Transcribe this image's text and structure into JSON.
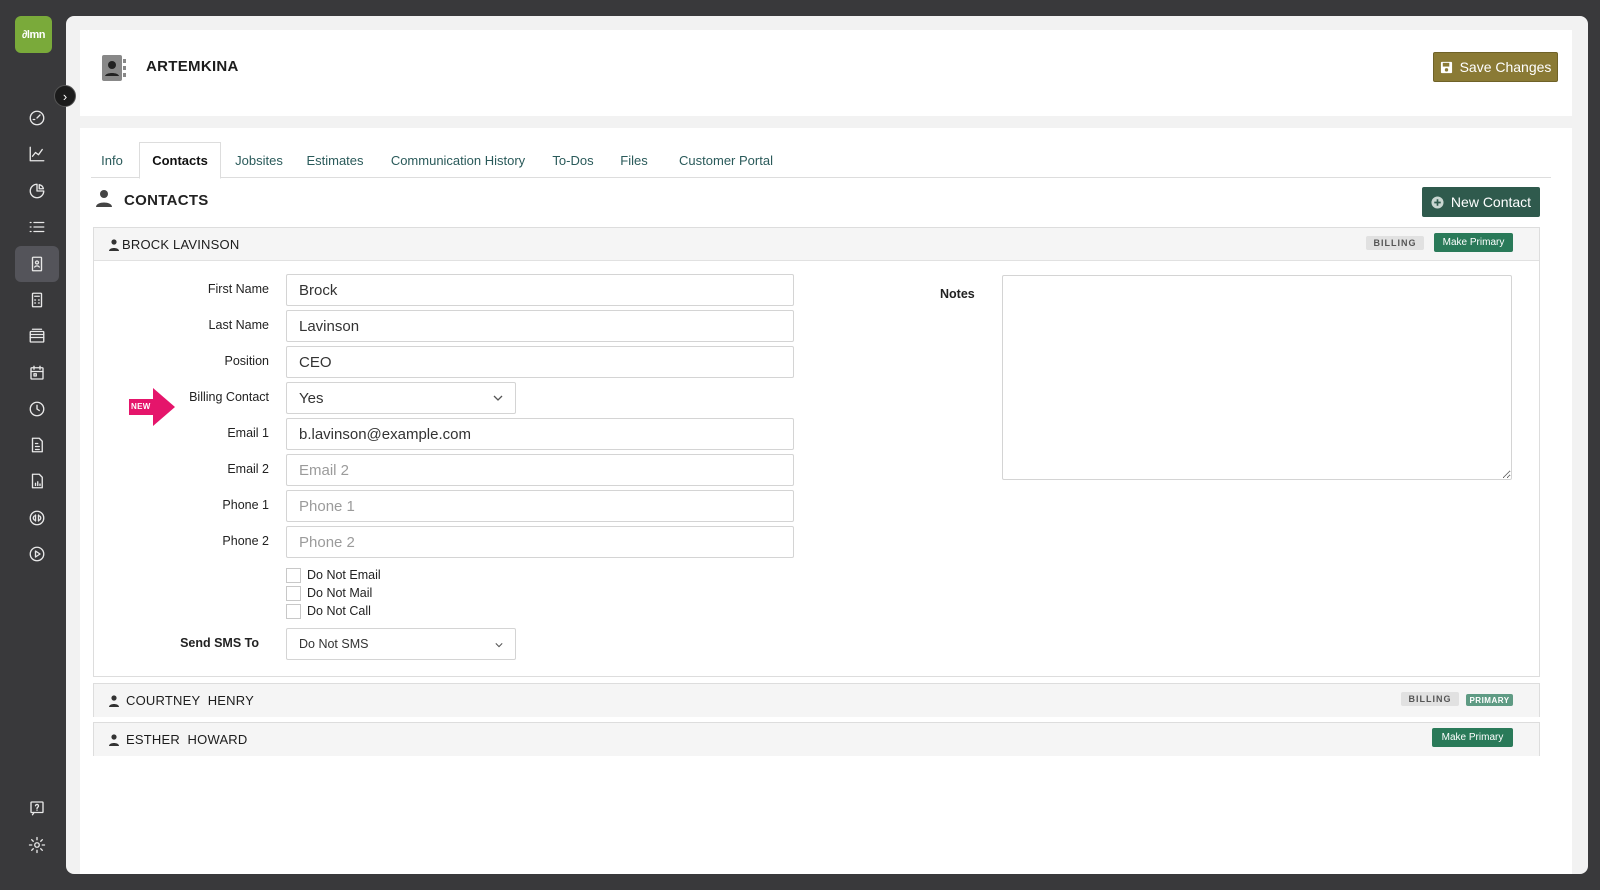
{
  "app": {
    "logo_text": "∂lmn"
  },
  "header": {
    "title": "ARTEMKINA",
    "save_label": "Save Changes"
  },
  "tabs": [
    {
      "label": "Info",
      "active": false
    },
    {
      "label": "Contacts",
      "active": true
    },
    {
      "label": "Jobsites",
      "active": false
    },
    {
      "label": "Estimates",
      "active": false
    },
    {
      "label": "Communication History",
      "active": false
    },
    {
      "label": "To-Dos",
      "active": false
    },
    {
      "label": "Files",
      "active": false
    },
    {
      "label": "Customer Portal",
      "active": false
    }
  ],
  "section": {
    "title": "CONTACTS",
    "new_contact_label": "New Contact"
  },
  "contacts": [
    {
      "name": "BROCK LAVINSON",
      "badges": [
        "BILLING"
      ],
      "action": "Make Primary",
      "expanded": true
    },
    {
      "name": "COURTNEY  HENRY",
      "badges": [
        "BILLING",
        "PRIMARY"
      ],
      "action": "",
      "expanded": false
    },
    {
      "name": "ESTHER  HOWARD",
      "badges": [],
      "action": "Make Primary",
      "expanded": false
    }
  ],
  "form": {
    "first_name": {
      "label": "First Name",
      "value": "Brock"
    },
    "last_name": {
      "label": "Last Name",
      "value": "Lavinson"
    },
    "position": {
      "label": "Position",
      "value": "CEO"
    },
    "billing_contact": {
      "label": "Billing Contact",
      "value": "Yes",
      "new_badge": "NEW"
    },
    "email1": {
      "label": "Email 1",
      "value": "b.lavinson@example.com"
    },
    "email2": {
      "label": "Email 2",
      "placeholder": "Email 2"
    },
    "phone1": {
      "label": "Phone 1",
      "placeholder": "Phone 1"
    },
    "phone2": {
      "label": "Phone 2",
      "placeholder": "Phone 2"
    },
    "checkboxes": [
      "Do Not Email",
      "Do Not Mail",
      "Do Not Call"
    ],
    "sms": {
      "label": "Send SMS To",
      "value": "Do Not SMS"
    },
    "notes": {
      "label": "Notes"
    }
  },
  "colors": {
    "save_button": "#8a7a35",
    "new_contact_button": "#2f5a4d",
    "make_primary": "#2a7a59",
    "primary_badge": "#5f9b84",
    "new_arrow": "#e5156b",
    "logo": "#7aaa3a"
  },
  "sidebar_icons": [
    "dashboard-icon",
    "analytics-icon",
    "pie-chart-icon",
    "list-icon",
    "contacts-icon",
    "calculator-icon",
    "layers-icon",
    "calendar-icon",
    "clock-icon",
    "document-icon",
    "file-chart-icon",
    "quickbooks-icon",
    "play-icon",
    "help-icon",
    "settings-icon"
  ]
}
